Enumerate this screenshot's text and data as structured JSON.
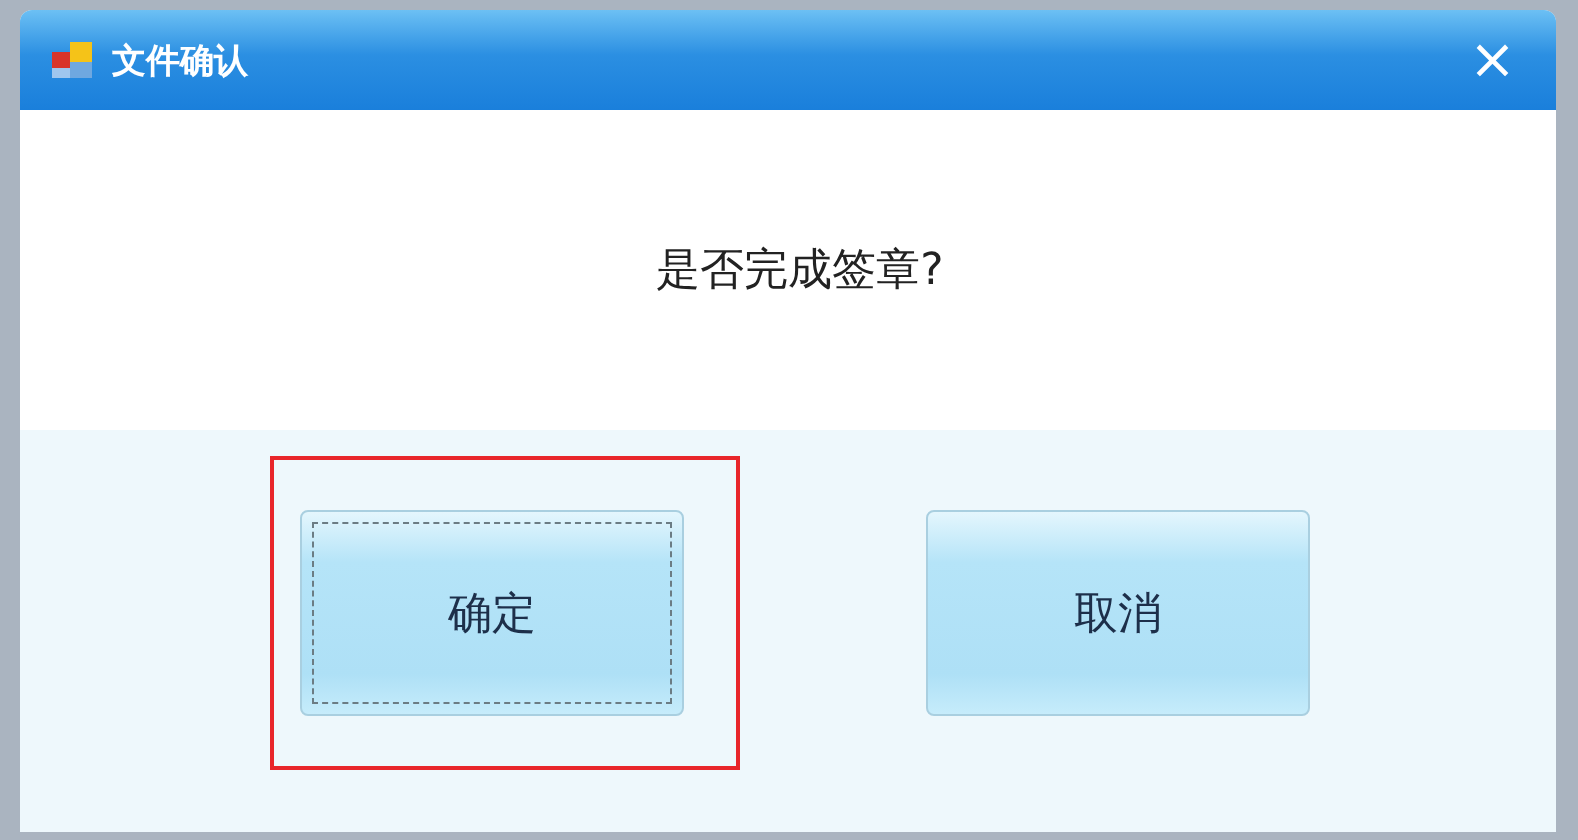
{
  "window": {
    "title": "文件确认",
    "close": "×"
  },
  "message": "是否完成签章?",
  "buttons": [
    {
      "label": "确定",
      "focused": true,
      "highlighted": true
    },
    {
      "label": "取消",
      "focused": false,
      "highlighted": false
    }
  ]
}
